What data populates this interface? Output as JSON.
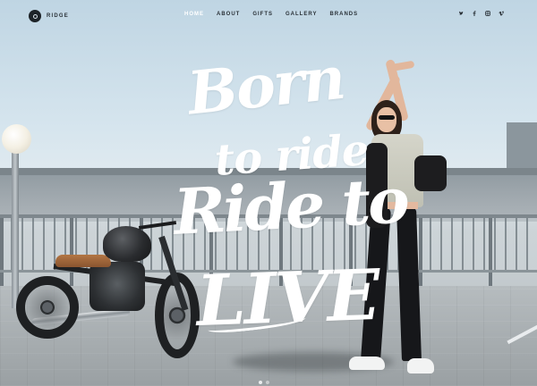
{
  "brand": {
    "name": "RIDGE",
    "icon": "brand-logo-icon"
  },
  "nav": {
    "items": [
      {
        "label": "HOME",
        "active": true
      },
      {
        "label": "ABOUT",
        "active": false
      },
      {
        "label": "GIFTS",
        "active": false
      },
      {
        "label": "GALLERY",
        "active": false
      },
      {
        "label": "BRANDS",
        "active": false
      }
    ],
    "active_color": "#ffffff",
    "color": "#2a3137"
  },
  "social": [
    {
      "name": "twitter-icon"
    },
    {
      "name": "facebook-icon"
    },
    {
      "name": "instagram-icon"
    },
    {
      "name": "vimeo-icon"
    }
  ],
  "hero": {
    "lines": [
      "Born",
      "to ride",
      "Ride to",
      "LIVE"
    ]
  },
  "slider": {
    "slide_count": 2,
    "active_index": 0
  }
}
